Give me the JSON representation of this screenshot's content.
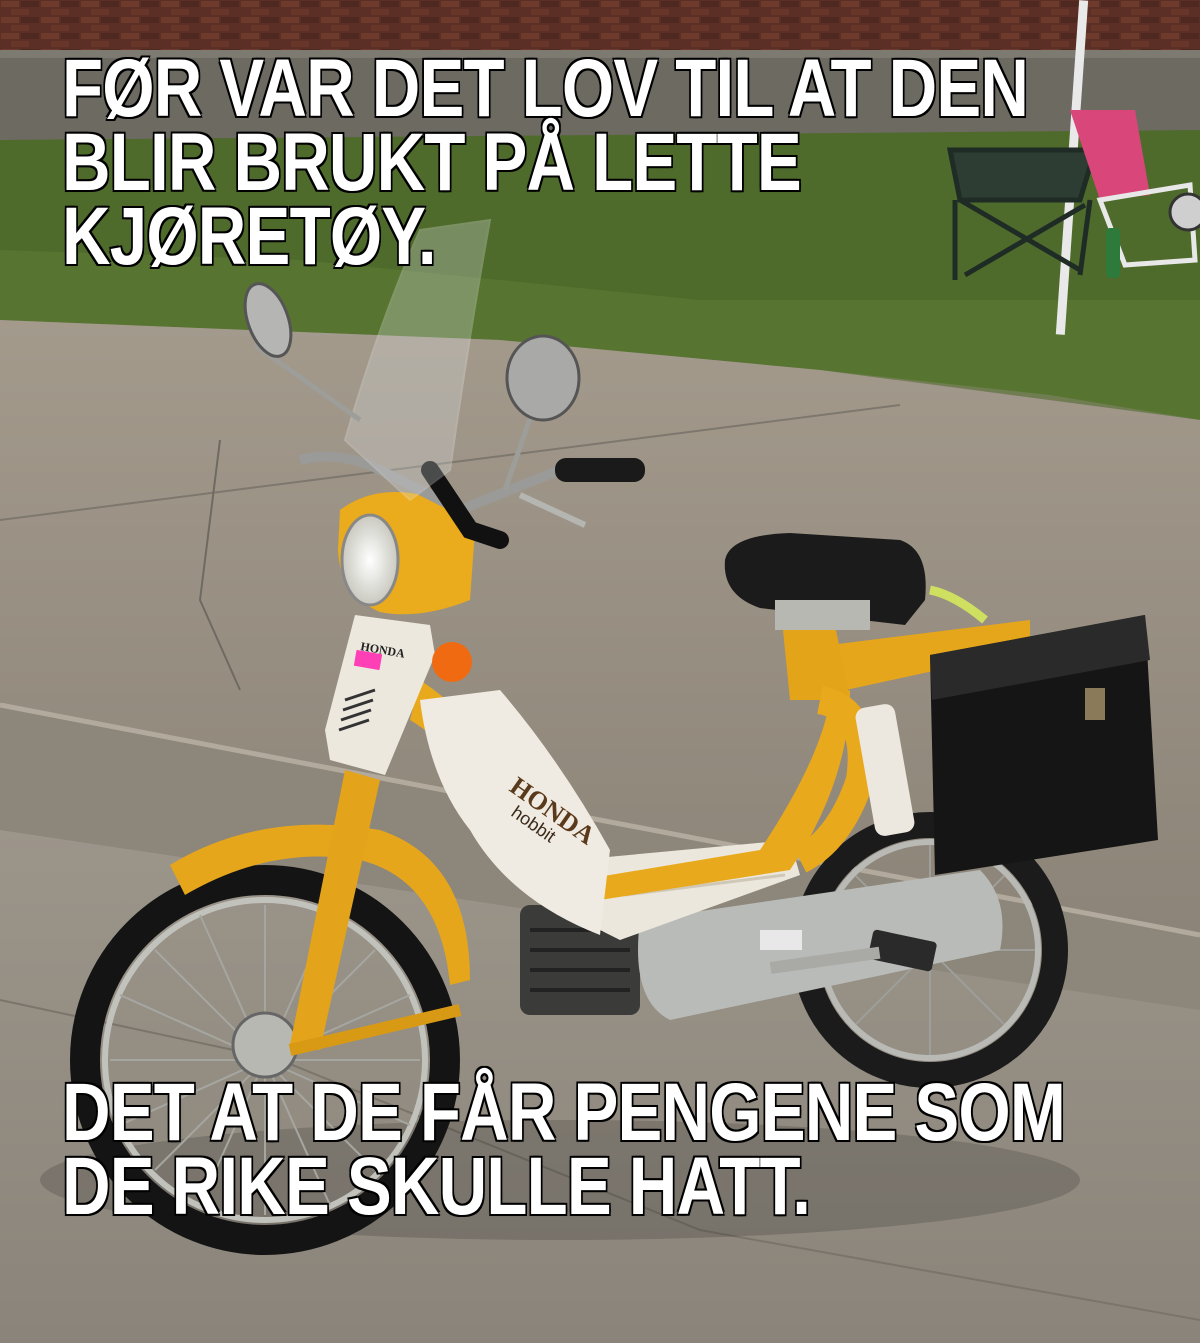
{
  "meme": {
    "top_text_lines": [
      "FØR VAR DET LOV TIL AT DEN",
      "BLIR BRUKT PÅ LETTE",
      "KJØRETØY."
    ],
    "bottom_text_lines": [
      "DET AT DE FÅR PENGENE SOM",
      "DE RIKE SKULLE HATT."
    ]
  },
  "photo": {
    "brand_label": "HONDA",
    "model_label": "hobbit"
  },
  "colors": {
    "frame_yellow": "#e8a81c",
    "body_white": "#efeae0",
    "seat_black": "#1a1a1a",
    "pavement": "#9a9286",
    "grass": "#4e6a2a",
    "brick": "#5a2e24"
  }
}
